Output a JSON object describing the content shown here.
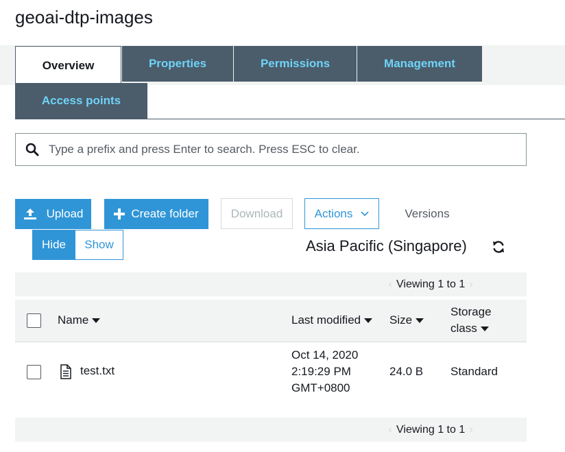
{
  "bucket": {
    "title": "geoai-dtp-images"
  },
  "tabs": [
    {
      "label": "Overview",
      "active": true
    },
    {
      "label": "Properties",
      "active": false
    },
    {
      "label": "Permissions",
      "active": false
    },
    {
      "label": "Management",
      "active": false
    },
    {
      "label": "Access points",
      "active": false
    }
  ],
  "search": {
    "placeholder": "Type a prefix and press Enter to search. Press ESC to clear.",
    "value": ""
  },
  "toolbar": {
    "upload_label": "Upload",
    "create_folder_label": "Create folder",
    "download_label": "Download",
    "actions_label": "Actions",
    "versions_label": "Versions",
    "hide_label": "Hide",
    "show_label": "Show"
  },
  "region": {
    "label": "Asia Pacific (Singapore)"
  },
  "pager": {
    "top_text": "Viewing 1 to 1",
    "bottom_text": "Viewing 1 to 1"
  },
  "table": {
    "columns": {
      "name": "Name",
      "last_modified": "Last modified",
      "size": "Size",
      "storage_class_line1": "Storage",
      "storage_class_line2": "class"
    },
    "rows": [
      {
        "name": "test.txt",
        "modified_date": "Oct 14, 2020",
        "modified_time": "2:19:29 PM",
        "modified_tz": "GMT+0800",
        "size": "24.0 B",
        "storage_class": "Standard"
      }
    ]
  },
  "colors": {
    "accent": "#2f95d7",
    "tab_bg": "#4b5c6b",
    "tab_text": "#6fd3f7",
    "panel_bg": "#f2f3f3"
  },
  "icons": {
    "search": "search-icon",
    "upload": "upload-icon",
    "plus": "plus-icon",
    "chevron": "chevron-down-icon",
    "refresh": "refresh-icon",
    "file": "document-icon"
  }
}
